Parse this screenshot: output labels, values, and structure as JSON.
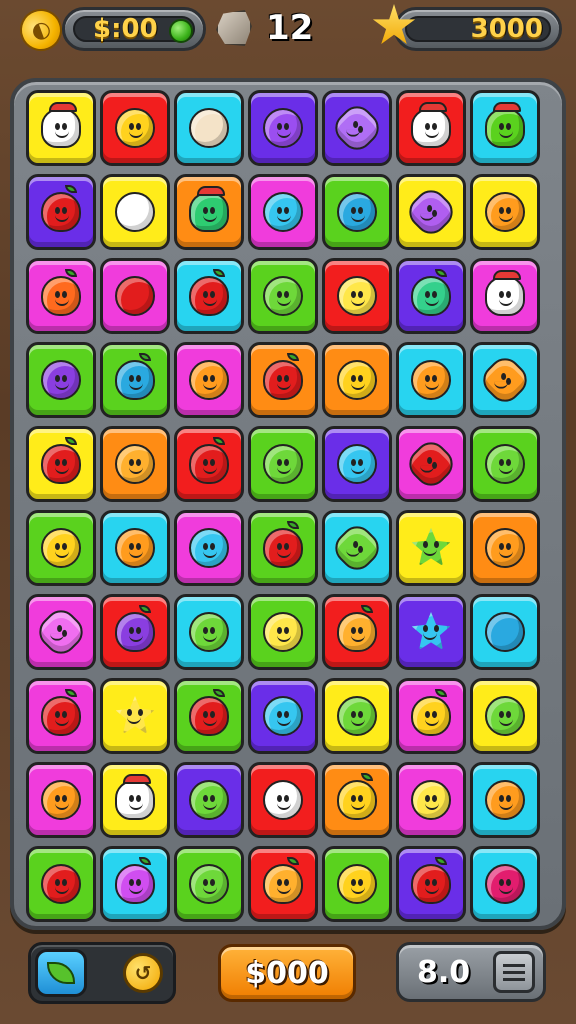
{
  "hud": {
    "coins": "$:00",
    "coin_icon": "coin-icon",
    "gem_icon": "green-gem-icon",
    "moves_icon": "rock-icon",
    "moves": "12",
    "score_icon": "star-icon",
    "score": "3000"
  },
  "bottom": {
    "booster_left_icon": "leaf-icon",
    "booster_right_icon": "clock-icon",
    "center_value": "$000",
    "level_value": "8.0",
    "menu_icon": "menu-icon"
  },
  "colors": {
    "yellow": "#ffec1a",
    "red": "#f21e1e",
    "cyan": "#28d4f0",
    "purple": "#6a2ee8",
    "orange": "#ff8c14",
    "magenta": "#f03cdc",
    "green": "#5ad21e"
  },
  "board": {
    "rows": [
      [
        {
          "tile": "yellow",
          "piece": "char",
          "pc": "#ffffff"
        },
        {
          "tile": "red",
          "piece": "face",
          "pc": "#ffd21e"
        },
        {
          "tile": "cyan",
          "piece": "plain",
          "pc": "#f4e3c8"
        },
        {
          "tile": "purple",
          "piece": "face",
          "pc": "#9b4ef0"
        },
        {
          "tile": "purple",
          "piece": "flower",
          "pc": "#b06ef5"
        },
        {
          "tile": "red",
          "piece": "char",
          "pc": "#ffffff"
        },
        {
          "tile": "cyan",
          "piece": "char",
          "pc": "#5ad21e"
        }
      ],
      [
        {
          "tile": "purple",
          "piece": "fruit",
          "pc": "#e21d1d"
        },
        {
          "tile": "yellow",
          "piece": "plain",
          "pc": "#ffffff"
        },
        {
          "tile": "orange",
          "piece": "char",
          "pc": "#2ecc71"
        },
        {
          "tile": "magenta",
          "piece": "face",
          "pc": "#36c6f0"
        },
        {
          "tile": "green",
          "piece": "face",
          "pc": "#2aa9e0"
        },
        {
          "tile": "yellow",
          "piece": "flower",
          "pc": "#b05ef0"
        },
        {
          "tile": "yellow",
          "piece": "face",
          "pc": "#ff9c1e"
        }
      ],
      [
        {
          "tile": "magenta",
          "piece": "fruit",
          "pc": "#ff6a1e"
        },
        {
          "tile": "magenta",
          "piece": "plain",
          "pc": "#e21d1d"
        },
        {
          "tile": "cyan",
          "piece": "fruit",
          "pc": "#e21d1d"
        },
        {
          "tile": "green",
          "piece": "face",
          "pc": "#6ed83a"
        },
        {
          "tile": "red",
          "piece": "face",
          "pc": "#ffe74a"
        },
        {
          "tile": "purple",
          "piece": "fruit",
          "pc": "#34d08c"
        },
        {
          "tile": "magenta",
          "piece": "char",
          "pc": "#ffffff"
        }
      ],
      [
        {
          "tile": "green",
          "piece": "face",
          "pc": "#8a3ee0"
        },
        {
          "tile": "green",
          "piece": "fruit",
          "pc": "#2aa9e0"
        },
        {
          "tile": "magenta",
          "piece": "face",
          "pc": "#ff9c1e"
        },
        {
          "tile": "orange",
          "piece": "fruit",
          "pc": "#e21d1d"
        },
        {
          "tile": "orange",
          "piece": "face",
          "pc": "#ffd21e"
        },
        {
          "tile": "cyan",
          "piece": "face",
          "pc": "#ff9c1e"
        },
        {
          "tile": "cyan",
          "piece": "flower",
          "pc": "#ff9c1e"
        }
      ],
      [
        {
          "tile": "yellow",
          "piece": "fruit",
          "pc": "#e21d1d"
        },
        {
          "tile": "orange",
          "piece": "face",
          "pc": "#ffb02e"
        },
        {
          "tile": "red",
          "piece": "fruit",
          "pc": "#e21d1d"
        },
        {
          "tile": "green",
          "piece": "face",
          "pc": "#6ed83a"
        },
        {
          "tile": "purple",
          "piece": "face",
          "pc": "#36c6f0"
        },
        {
          "tile": "magenta",
          "piece": "flower",
          "pc": "#e21d1d"
        },
        {
          "tile": "green",
          "piece": "face",
          "pc": "#6ed83a"
        }
      ],
      [
        {
          "tile": "green",
          "piece": "face",
          "pc": "#ffd21e"
        },
        {
          "tile": "cyan",
          "piece": "face",
          "pc": "#ff9c1e"
        },
        {
          "tile": "magenta",
          "piece": "face",
          "pc": "#36c6f0"
        },
        {
          "tile": "green",
          "piece": "fruit",
          "pc": "#e21d1d"
        },
        {
          "tile": "cyan",
          "piece": "flower",
          "pc": "#6ed83a"
        },
        {
          "tile": "yellow",
          "piece": "star",
          "pc": "#6ed83a"
        },
        {
          "tile": "orange",
          "piece": "face",
          "pc": "#ff9c1e"
        }
      ],
      [
        {
          "tile": "magenta",
          "piece": "flower",
          "pc": "#f06ef0"
        },
        {
          "tile": "red",
          "piece": "fruit",
          "pc": "#8a3ee0"
        },
        {
          "tile": "cyan",
          "piece": "face",
          "pc": "#6ed83a"
        },
        {
          "tile": "green",
          "piece": "face",
          "pc": "#ffe74a"
        },
        {
          "tile": "red",
          "piece": "fruit",
          "pc": "#ffb02e"
        },
        {
          "tile": "purple",
          "piece": "star",
          "pc": "#36c6f0"
        },
        {
          "tile": "cyan",
          "piece": "plain",
          "pc": "#2aa9e0"
        }
      ],
      [
        {
          "tile": "magenta",
          "piece": "fruit",
          "pc": "#e21d1d"
        },
        {
          "tile": "yellow",
          "piece": "star",
          "pc": "#ffe74a"
        },
        {
          "tile": "green",
          "piece": "fruit",
          "pc": "#e21d1d"
        },
        {
          "tile": "purple",
          "piece": "face",
          "pc": "#36c6f0"
        },
        {
          "tile": "yellow",
          "piece": "face",
          "pc": "#6ed83a"
        },
        {
          "tile": "magenta",
          "piece": "fruit",
          "pc": "#ffd21e"
        },
        {
          "tile": "yellow",
          "piece": "face",
          "pc": "#6ed83a"
        }
      ],
      [
        {
          "tile": "magenta",
          "piece": "face",
          "pc": "#ff9c1e"
        },
        {
          "tile": "yellow",
          "piece": "char",
          "pc": "#ffffff"
        },
        {
          "tile": "purple",
          "piece": "face",
          "pc": "#6ed83a"
        },
        {
          "tile": "red",
          "piece": "face",
          "pc": "#ffffff"
        },
        {
          "tile": "orange",
          "piece": "fruit",
          "pc": "#ffd21e"
        },
        {
          "tile": "magenta",
          "piece": "face",
          "pc": "#ffe74a"
        },
        {
          "tile": "cyan",
          "piece": "face",
          "pc": "#ff9c1e"
        }
      ],
      [
        {
          "tile": "green",
          "piece": "face",
          "pc": "#e21d1d"
        },
        {
          "tile": "cyan",
          "piece": "fruit",
          "pc": "#d04ef0"
        },
        {
          "tile": "green",
          "piece": "face",
          "pc": "#6ed83a"
        },
        {
          "tile": "red",
          "piece": "fruit",
          "pc": "#ffb02e"
        },
        {
          "tile": "green",
          "piece": "face",
          "pc": "#ffd21e"
        },
        {
          "tile": "purple",
          "piece": "fruit",
          "pc": "#e21d1d"
        },
        {
          "tile": "cyan",
          "piece": "face",
          "pc": "#e21d6e"
        }
      ]
    ]
  }
}
